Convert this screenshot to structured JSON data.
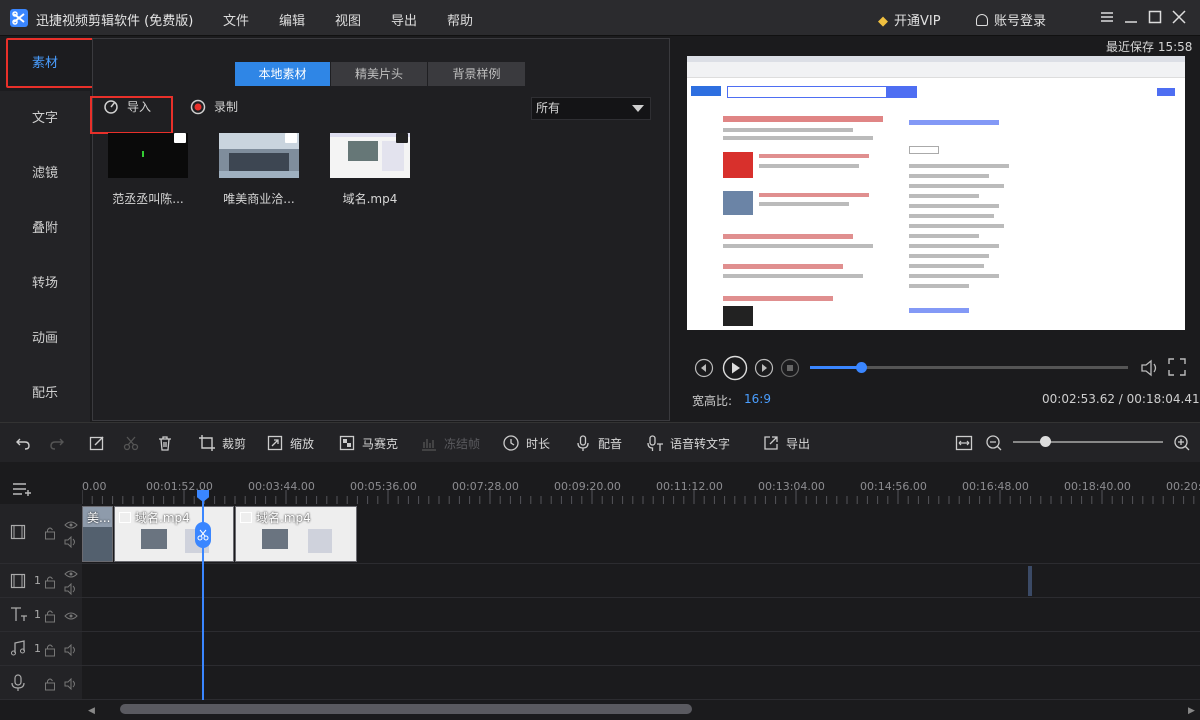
{
  "app": {
    "title": "迅捷视频剪辑软件 (免费版)"
  },
  "menu": [
    "文件",
    "编辑",
    "视图",
    "导出",
    "帮助"
  ],
  "header": {
    "vip_label": "开通VIP",
    "account_label": "账号登录"
  },
  "rail": {
    "items": [
      "素材",
      "文字",
      "滤镜",
      "叠附",
      "转场",
      "动画",
      "配乐"
    ],
    "active_index": 0
  },
  "media": {
    "tabs": [
      "本地素材",
      "精美片头",
      "背景样例"
    ],
    "active_tab": 0,
    "import_label": "导入",
    "record_label": "录制",
    "filter_value": "所有",
    "items": [
      {
        "label": "范丞丞叫陈..."
      },
      {
        "label": "唯美商业洽..."
      },
      {
        "label": "域名.mp4"
      }
    ]
  },
  "preview": {
    "save_status": "最近保存 15:58",
    "aspect_label": "宽高比:",
    "aspect_value": "16:9",
    "time": "00:02:53.62 / 00:18:04.41",
    "progress": 0.16
  },
  "toolbar": {
    "crop": "裁剪",
    "zoom": "缩放",
    "mosaic": "马赛克",
    "freeze": "冻结帧",
    "duration": "时长",
    "dub": "配音",
    "speech_to_text": "语音转文字",
    "export": "导出"
  },
  "timeline": {
    "ticks": [
      "0.00",
      "00:01:52.00",
      "00:03:44.00",
      "00:05:36.00",
      "00:07:28.00",
      "00:09:20.00",
      "00:11:12.00",
      "00:13:04.00",
      "00:14:56.00",
      "00:16:48.00",
      "00:18:40.00",
      "00:20:"
    ],
    "clips": [
      {
        "label": "美..."
      },
      {
        "label": "域名.mp4"
      },
      {
        "label": "域名.mp4"
      }
    ],
    "track_numbers": [
      "1",
      "1",
      "1"
    ]
  },
  "colors": {
    "accent": "#3a86ff",
    "highlight": "#e8302a"
  }
}
